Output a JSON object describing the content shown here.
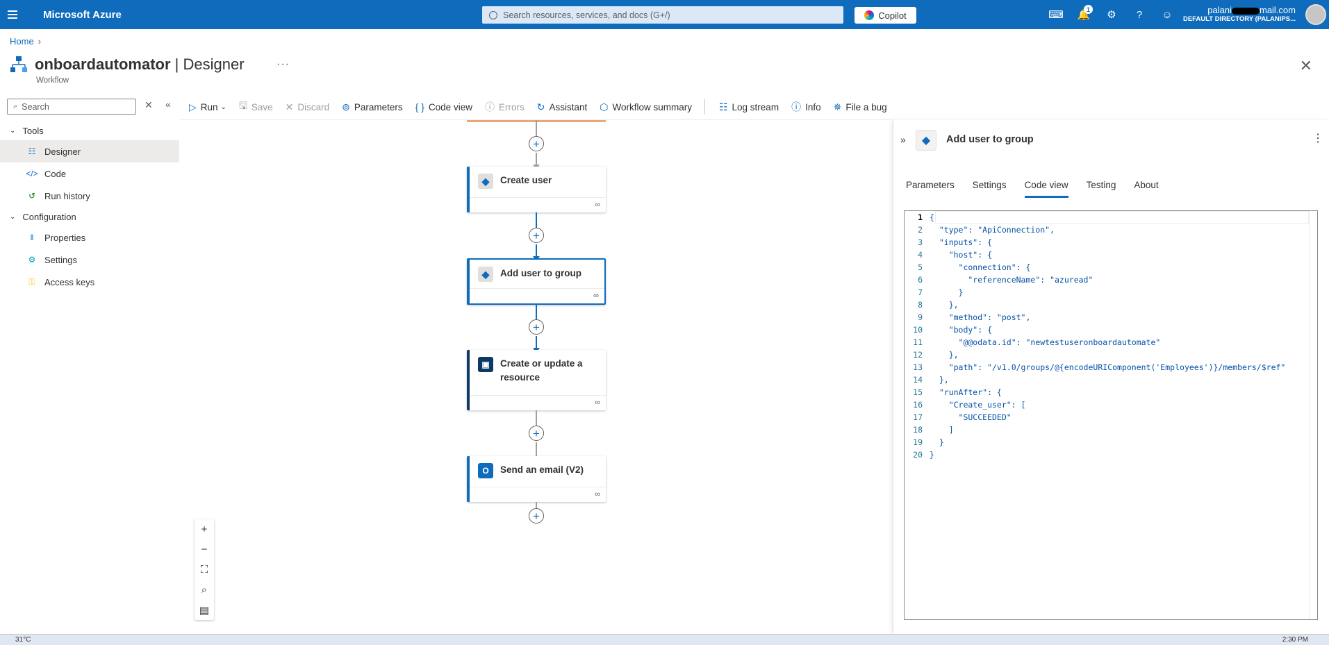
{
  "topbar": {
    "brand": "Microsoft Azure",
    "search_placeholder": "Search resources, services, and docs (G+/)",
    "copilot_label": "Copilot",
    "notification_count": "1",
    "account_email_start": "palani",
    "account_email_end": "mail.com",
    "account_directory": "DEFAULT DIRECTORY (PALANIPS..."
  },
  "breadcrumb": {
    "home": "Home"
  },
  "header": {
    "resource_name": "onboardautomator",
    "separator": " | ",
    "page_name": "Designer",
    "subtitle": "Workflow"
  },
  "sidebar": {
    "search_placeholder": "Search",
    "groups": [
      {
        "label": "Tools",
        "items": [
          "Designer",
          "Code",
          "Run history"
        ]
      },
      {
        "label": "Configuration",
        "items": [
          "Properties",
          "Settings",
          "Access keys"
        ]
      }
    ]
  },
  "toolbar": {
    "run": "Run",
    "save": "Save",
    "discard": "Discard",
    "parameters": "Parameters",
    "code_view": "Code view",
    "errors": "Errors",
    "assistant": "Assistant",
    "workflow_summary": "Workflow summary",
    "log_stream": "Log stream",
    "info": "Info",
    "file_bug": "File a bug"
  },
  "workflow": {
    "steps": [
      {
        "title": "Create user",
        "selected": false
      },
      {
        "title": "Add user to group",
        "selected": true
      },
      {
        "title": "Create or update a resource",
        "selected": false
      },
      {
        "title": "Send an email (V2)",
        "selected": false
      }
    ]
  },
  "panel": {
    "title": "Add user to group",
    "tabs": [
      "Parameters",
      "Settings",
      "Code view",
      "Testing",
      "About"
    ],
    "active_tab": "Code view",
    "code_lines": [
      "{",
      "  \"type\": \"ApiConnection\",",
      "  \"inputs\": {",
      "    \"host\": {",
      "      \"connection\": {",
      "        \"referenceName\": \"azuread\"",
      "      }",
      "    },",
      "    \"method\": \"post\",",
      "    \"body\": {",
      "      \"@@odata.id\": \"newtestuseronboardautomate\"",
      "    },",
      "    \"path\": \"/v1.0/groups/@{encodeURIComponent('Employees')}/members/$ref\"",
      "  },",
      "  \"runAfter\": {",
      "    \"Create_user\": [",
      "      \"SUCCEEDED\"",
      "    ]",
      "  }",
      "}"
    ]
  },
  "taskbar": {
    "weather": "31°C",
    "clock": "2:30 PM"
  },
  "colors": {
    "azure_blue": "#0f6cbd",
    "resource_dark": "#0b3a66"
  }
}
